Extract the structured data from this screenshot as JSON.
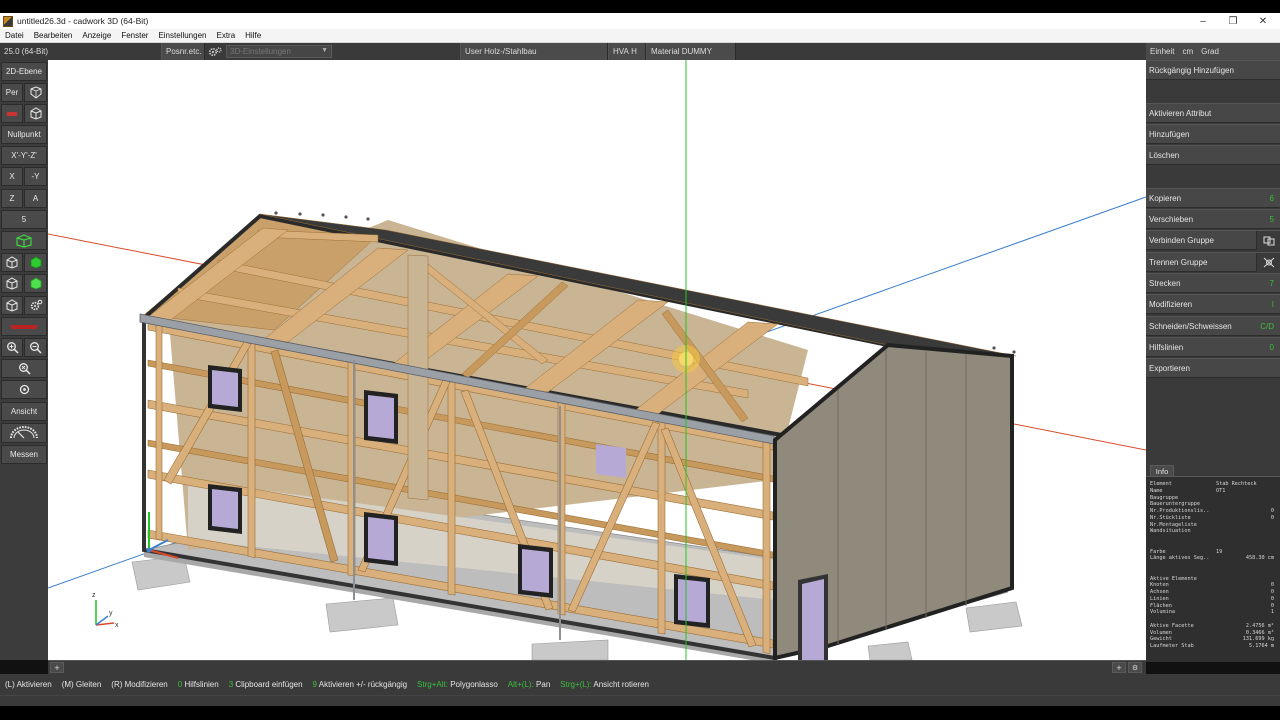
{
  "window": {
    "title": "untitled26.3d - cadwork 3D (64-Bit)",
    "controls": {
      "minimize": "–",
      "maximize": "❐",
      "close": "✕"
    }
  },
  "menu": [
    "Datei",
    "Bearbeiten",
    "Anzeige",
    "Fenster",
    "Einstellungen",
    "Extra",
    "Hilfe"
  ],
  "infobar": {
    "version": "25.0 (64-Bit)",
    "posnr": "Posnr.etc.",
    "settings_placeholder": "3D-Einstellungen",
    "user_label": "User",
    "user_value": "Holz-/Stahlbau",
    "hva_label": "HVA",
    "hva_value": "H",
    "material_label": "Material",
    "material_value": "DUMMY"
  },
  "left_toolbar": {
    "ebene": "2D-Ebene",
    "per": "Per",
    "nullpunkt": "Nullpunkt",
    "xyz": "X'-Y'-Z'",
    "x": "X",
    "minus_y": "-Y",
    "z": "Z",
    "a": "A",
    "five": "5",
    "ansicht": "Ansicht",
    "messen": "Messen"
  },
  "right_panel": {
    "units": [
      "Einheit",
      "cm",
      "Grad"
    ],
    "buttons": [
      {
        "label": "Rückgängig Hinzufügen"
      },
      {
        "label": "Aktivieren Attribut"
      },
      {
        "label": "Hinzufügen"
      },
      {
        "label": "Löschen"
      },
      {
        "label": "Kopieren",
        "accel": "6"
      },
      {
        "label": "Verschieben",
        "accel": "5"
      },
      {
        "label": "Verbinden Gruppe"
      },
      {
        "label": "Trennen Gruppe"
      },
      {
        "label": "Strecken",
        "accel": "7"
      },
      {
        "label": "Modifizieren",
        "accel": "I"
      },
      {
        "label": "Schneiden/Schweissen",
        "accel": "C/D"
      },
      {
        "label": "Hilfslinien",
        "accel": "0"
      },
      {
        "label": "Exportieren"
      }
    ]
  },
  "info": {
    "tab": "Info",
    "rows": [
      {
        "k": "Element",
        "v": "Stab Rechteck",
        "n": ""
      },
      {
        "k": "Name",
        "v": "OT1",
        "n": ""
      },
      {
        "k": "Baugruppe",
        "v": "",
        "n": ""
      },
      {
        "k": "Baueruntergruppe",
        "v": "",
        "n": ""
      },
      {
        "k": "Nr.Produktionslis..",
        "v": "",
        "n": "0"
      },
      {
        "k": "Nr.Stückliste",
        "v": "",
        "n": "0"
      },
      {
        "k": "Nr.Montageliste",
        "v": "",
        "n": ""
      },
      {
        "k": "Wandsituation",
        "v": "",
        "n": ""
      },
      {
        "k": "",
        "v": "",
        "n": ""
      },
      {
        "k": "",
        "v": "",
        "n": ""
      },
      {
        "k": "Farbe",
        "v": "19",
        "n": ""
      },
      {
        "k": "Länge aktives Seg..",
        "v": "",
        "n": "458.30 cm"
      },
      {
        "k": "",
        "v": "",
        "n": ""
      },
      {
        "k": "",
        "v": "",
        "n": ""
      },
      {
        "k": "Aktive Elemente",
        "v": "",
        "n": ""
      },
      {
        "k": "Knoten",
        "v": "",
        "n": "0"
      },
      {
        "k": "Achsen",
        "v": "",
        "n": "0"
      },
      {
        "k": "Linien",
        "v": "",
        "n": "0"
      },
      {
        "k": "Flächen",
        "v": "",
        "n": "0"
      },
      {
        "k": "Volumina",
        "v": "",
        "n": "1"
      },
      {
        "k": "",
        "v": "",
        "n": ""
      },
      {
        "k": "Aktive Facette",
        "v": "",
        "n": "2.4756 m²"
      },
      {
        "k": "Volumen",
        "v": "",
        "n": "0.3466 m³"
      },
      {
        "k": "Gewicht",
        "v": "",
        "n": "131.699 kg"
      },
      {
        "k": "Laufmeter Stab",
        "v": "",
        "n": "5.1764 m"
      }
    ]
  },
  "statusbar": [
    {
      "key": "(L)",
      "text": "Aktivieren"
    },
    {
      "key": "(M)",
      "text": "Gleiten"
    },
    {
      "key": "(R)",
      "text": "Modifizieren"
    },
    {
      "key": "0",
      "text": "Hilfslinien"
    },
    {
      "key": "3",
      "text": "Clipboard einfügen"
    },
    {
      "key": "9",
      "text": "Aktivieren +/- rückgängig"
    },
    {
      "key": "Strg+Alt:",
      "text": "Polygonlasso"
    },
    {
      "key": "Alt+(L):",
      "text": "Pan"
    },
    {
      "key": "Strg+(L):",
      "text": "Ansicht rotieren"
    }
  ],
  "axis_labels": {
    "x": "x",
    "y": "y",
    "z": "z"
  },
  "colors": {
    "timber": "#d9b07c",
    "timber_dark": "#b8894f",
    "insulation": "#c8b596",
    "cladding": "#8f8a7c",
    "frame": "#333333",
    "axis_green": "#22c422",
    "axis_red": "#d84a2a",
    "axis_blue": "#3a7fd0",
    "concrete": "#c9c9c9",
    "accent_green": "#3cbf3c"
  }
}
